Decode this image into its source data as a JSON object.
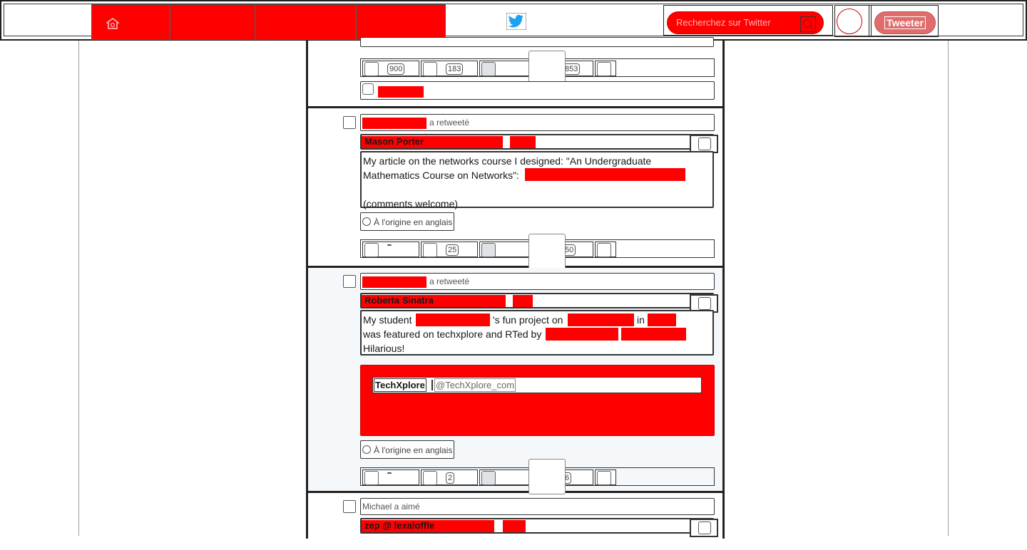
{
  "nav": {
    "search_placeholder": "Recherchez sur Twitter",
    "tweet_button": "Tweeter",
    "colors": {
      "redaction": "#ff0000",
      "tweet_button": "#e06c6c",
      "twitter_blue": "#1da1f2"
    }
  },
  "tweets": [
    {
      "id": "t0",
      "actions": {
        "reply": "900",
        "retweet": "183",
        "like": "853"
      }
    },
    {
      "id": "t1",
      "context": "a retweeté",
      "author": "Mason Porter",
      "text_line1": "My article on the networks course I designed: \"An Undergraduate",
      "text_line2": "Mathematics Course on Networks\":",
      "text_line3": "(comments welcome)",
      "translate": "À l'origine en anglais",
      "actions": {
        "reply": "",
        "retweet": "25",
        "like": "50"
      }
    },
    {
      "id": "t2",
      "context": "a retweeté",
      "author": "Roberta Sinatra",
      "text_p1": "My student",
      "text_p2": "'s fun project on",
      "text_p3": "in",
      "text_line2": "was featured on techxplore and RTed by",
      "text_line3": "Hilarious!",
      "quote_name": "TechXplore",
      "quote_handle": "@TechXplore_com",
      "translate": "À l'origine en anglais",
      "actions": {
        "reply": "",
        "retweet": "2",
        "like": "6"
      }
    },
    {
      "id": "t3",
      "context": "Michael a aimé",
      "author": "zep @ lexaloffle"
    }
  ]
}
